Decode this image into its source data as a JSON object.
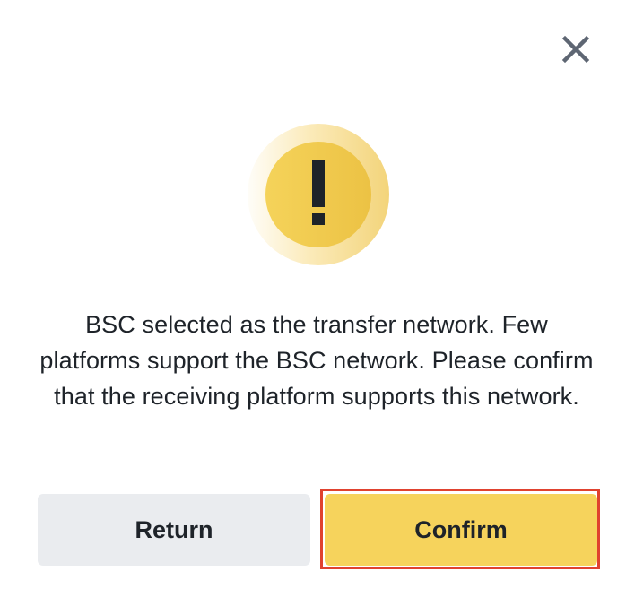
{
  "dialog": {
    "close_icon": "close-icon",
    "warning_icon": "exclamation-icon",
    "message": "BSC selected as the transfer network. Few platforms support the BSC network. Please confirm that the receiving platform supports this network.",
    "buttons": {
      "return_label": "Return",
      "confirm_label": "Confirm"
    }
  },
  "colors": {
    "warning_yellow": "#F0C544",
    "confirm_bg": "#F6D35C",
    "return_bg": "#EAECEF",
    "highlight_border": "#E0422F",
    "close_icon": "#5E6673"
  }
}
